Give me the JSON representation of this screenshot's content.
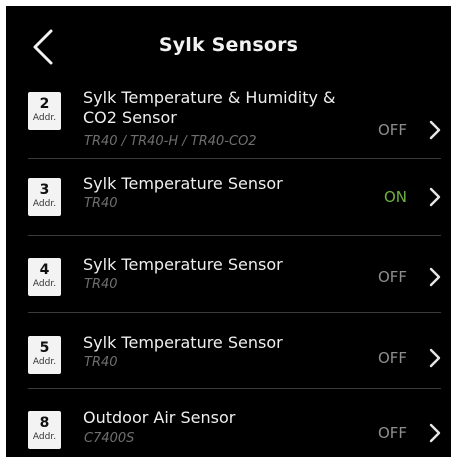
{
  "header": {
    "title": "Sylk Sensors"
  },
  "sensors": [
    {
      "addr": "2",
      "addr_label": "Addr.",
      "name": "Sylk Temperature & Humidity & CO2 Sensor",
      "model": "TR40 / TR40-H / TR40-CO2",
      "status": "OFF",
      "status_color": "#8e8e8e"
    },
    {
      "addr": "3",
      "addr_label": "Addr.",
      "name": "Sylk Temperature Sensor",
      "model": "TR40",
      "status": "ON",
      "status_color": "#6db33f"
    },
    {
      "addr": "4",
      "addr_label": "Addr.",
      "name": "Sylk Temperature Sensor",
      "model": "TR40",
      "status": "OFF",
      "status_color": "#8e8e8e"
    },
    {
      "addr": "5",
      "addr_label": "Addr.",
      "name": "Sylk Temperature Sensor",
      "model": "TR40",
      "status": "OFF",
      "status_color": "#8e8e8e"
    },
    {
      "addr": "8",
      "addr_label": "Addr.",
      "name": "Outdoor Air Sensor",
      "model": "C7400S",
      "status": "OFF",
      "status_color": "#8e8e8e"
    }
  ],
  "icons": {
    "back": "chevron-left-icon",
    "row_arrow": "chevron-right-icon"
  },
  "colors": {
    "background": "#000000",
    "text": "#efefef",
    "muted": "#6f6f6f",
    "on": "#6db33f",
    "off": "#8e8e8e"
  }
}
